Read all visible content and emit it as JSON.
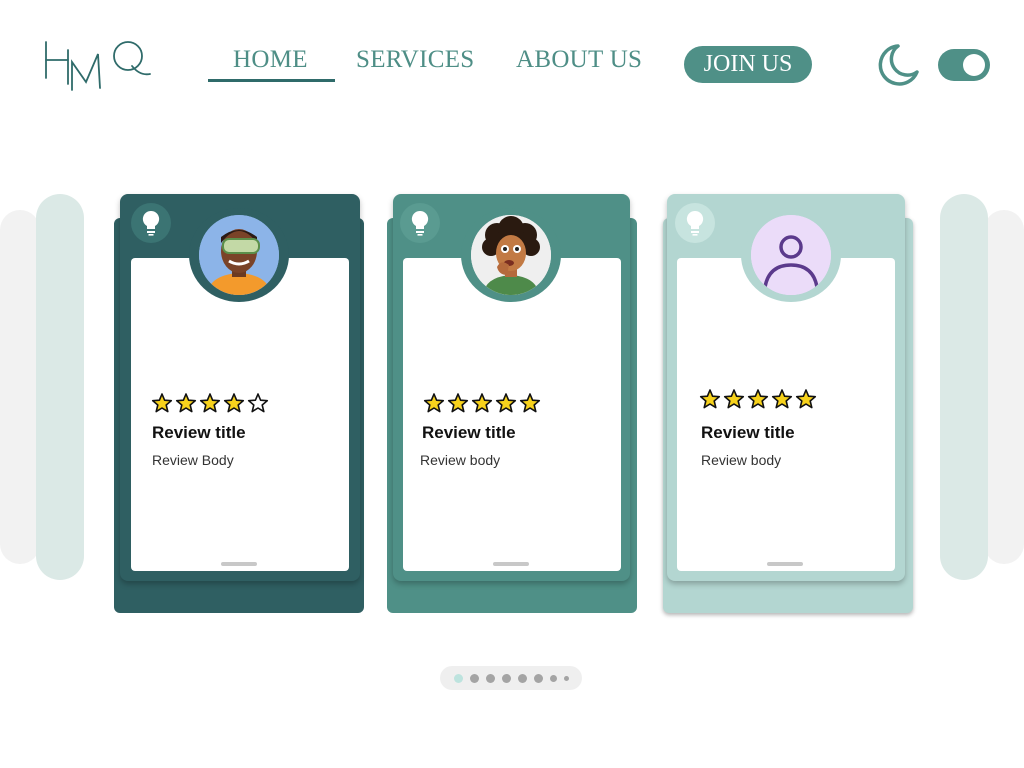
{
  "brand": {
    "logo_text": "HMQ",
    "color": "#2f6b6a"
  },
  "nav": {
    "items": [
      {
        "label": "HOME",
        "active": true
      },
      {
        "label": "SERVICES",
        "active": false
      },
      {
        "label": "ABOUT US",
        "active": false
      }
    ],
    "cta_label": "JOIN US"
  },
  "theme": {
    "dark_mode_icon": "moon-icon",
    "toggle_on": true,
    "accent": "#4f9087"
  },
  "cards": [
    {
      "title": "Review title",
      "body": "Review Body",
      "rating": 4,
      "avatar": "avatar-vr-man",
      "icon": "lightbulb-icon",
      "color": "#2f5f62",
      "light_color": "#3b7473"
    },
    {
      "title": "Review title",
      "body": "Review body",
      "rating": 5,
      "avatar": "avatar-curly-woman",
      "icon": "lightbulb-icon",
      "color": "#4f9087",
      "light_color": "#5a9b91"
    },
    {
      "title": "Review title",
      "body": "Review body",
      "rating": 5,
      "avatar": "avatar-placeholder",
      "icon": "lightbulb-icon",
      "color": "#b3d6d1",
      "light_color": "#c7e4df"
    }
  ],
  "pagination": {
    "count": 8,
    "active_index": 0
  }
}
